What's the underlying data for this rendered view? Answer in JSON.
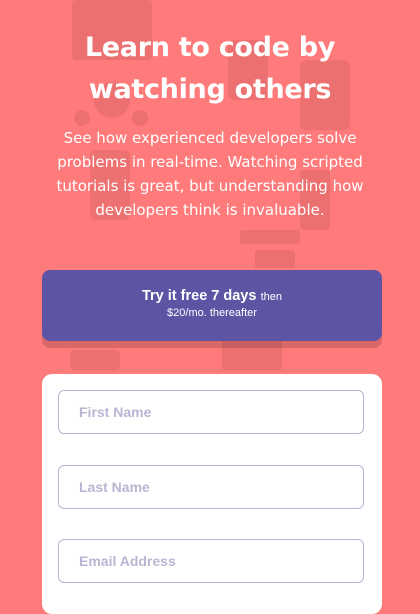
{
  "hero": {
    "title_line1": "Learn to code by",
    "title_line2": "watching others",
    "subtitle": "See how experienced developers solve problems in real-time. Watching scripted tutorials is great, but understanding how developers think is invaluable."
  },
  "cta": {
    "strong": "Try it free 7 days",
    "then": "then",
    "price": "$20/mo. thereafter"
  },
  "form": {
    "first_name_placeholder": "First Name",
    "last_name_placeholder": "Last Name",
    "email_placeholder": "Email Address"
  },
  "colors": {
    "background": "#ff7a7a",
    "cta": "#5e54a4",
    "placeholder": "#b9b6d3"
  }
}
